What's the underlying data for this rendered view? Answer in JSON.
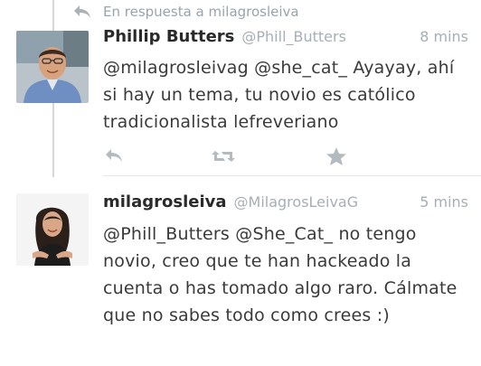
{
  "reply_context": {
    "text": "En respuesta a milagrosleiva"
  },
  "tweets": [
    {
      "display_name": "Phillip Butters",
      "handle": "@Phill_Butters",
      "time": "8 mins",
      "text": "@milagrosleivag @she_cat_ Ayayay, ahí si hay un tema, tu novio es católico tradicionalista lefreveriano"
    },
    {
      "display_name": "milagrosleiva",
      "handle": "@MilagrosLeivaG",
      "time": "5 mins",
      "text": "@Phill_Butters @She_Cat_ no tengo novio, creo que te han hackeado la cuenta o has tomado algo raro. Cálmate que no sabes todo como crees :)"
    }
  ],
  "icons": {
    "reply": "reply-icon",
    "retweet": "retweet-icon",
    "favorite": "star-icon"
  },
  "colors": {
    "muted": "#9aa4ab",
    "text": "#3a3a3a",
    "thread_line": "#d4d8db"
  }
}
